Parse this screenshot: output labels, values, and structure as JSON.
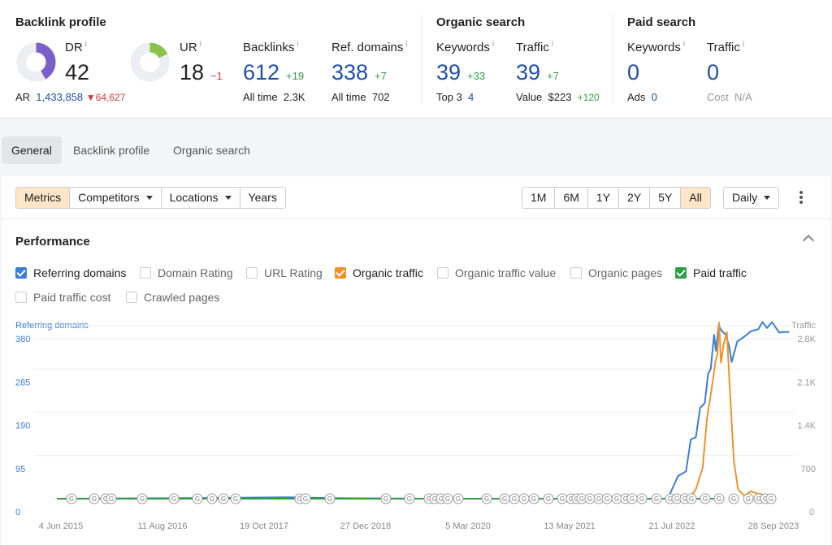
{
  "backlink_profile": {
    "title": "Backlink profile",
    "dr": {
      "label": "DR",
      "info": "i",
      "value": "42",
      "fill_percent": 42,
      "color": "#7a5fc9"
    },
    "ar": {
      "label": "AR",
      "value": "1,433,858",
      "delta": "64,627"
    },
    "ur": {
      "label": "UR",
      "info": "i",
      "value": "18",
      "delta": "−1",
      "fill_percent": 18,
      "color": "#8bc34a"
    },
    "backlinks": {
      "label": "Backlinks",
      "info": "i",
      "value": "612",
      "delta": "+19",
      "sub_label": "All time",
      "sub_value": "2.3K"
    },
    "ref_domains": {
      "label": "Ref. domains",
      "info": "i",
      "value": "338",
      "delta": "+7",
      "sub_label": "All time",
      "sub_value": "702"
    }
  },
  "organic_search": {
    "title": "Organic search",
    "keywords": {
      "label": "Keywords",
      "info": "i",
      "value": "39",
      "delta": "+33",
      "sub_label": "Top 3",
      "sub_value": "4"
    },
    "traffic": {
      "label": "Traffic",
      "info": "i",
      "value": "39",
      "delta": "+7",
      "sub_label": "Value",
      "sub_value": "$223",
      "sub_delta": "+120"
    }
  },
  "paid_search": {
    "title": "Paid search",
    "keywords": {
      "label": "Keywords",
      "info": "i",
      "value": "0",
      "sub_label": "Ads",
      "sub_value": "0"
    },
    "traffic": {
      "label": "Traffic",
      "info": "i",
      "value": "0",
      "sub_label": "Cost",
      "sub_value": "N/A"
    }
  },
  "tabs": [
    "General",
    "Backlink profile",
    "Organic search"
  ],
  "toolbar": {
    "metrics": "Metrics",
    "competitors": "Competitors",
    "locations": "Locations",
    "years": "Years",
    "ranges": [
      "1M",
      "6M",
      "1Y",
      "2Y",
      "5Y",
      "All"
    ],
    "active_range": "All",
    "interval": "Daily"
  },
  "performance": {
    "title": "Performance",
    "checkboxes": [
      {
        "label": "Referring domains",
        "checked": true,
        "color": "#3b7dd8"
      },
      {
        "label": "Domain Rating",
        "checked": false
      },
      {
        "label": "URL Rating",
        "checked": false
      },
      {
        "label": "Organic traffic",
        "checked": true,
        "color": "#f0922b"
      },
      {
        "label": "Organic traffic value",
        "checked": false
      },
      {
        "label": "Organic pages",
        "checked": false
      },
      {
        "label": "Paid traffic",
        "checked": true,
        "color": "#2f9e44"
      },
      {
        "label": "Paid traffic cost",
        "checked": false
      },
      {
        "label": "Crawled pages",
        "checked": false
      }
    ]
  },
  "chart_data": {
    "type": "line",
    "left_axis_label": "Referring domains",
    "right_axis_label": "Traffic",
    "left_ticks": [
      "0",
      "95",
      "190",
      "285",
      "380"
    ],
    "right_ticks": [
      "",
      "700",
      "1.4K",
      "2.1K",
      "2.8K"
    ],
    "left_ylim": [
      0,
      380
    ],
    "right_ylim": [
      0,
      2800
    ],
    "x_ticks": [
      "4 Jun 2015",
      "11 Aug 2016",
      "19 Oct 2017",
      "27 Dec 2018",
      "5 Mar 2020",
      "13 May 2021",
      "21 Jul 2022",
      "28 Sep 2023"
    ],
    "xlim": [
      "2015-01-01",
      "2023-11-15"
    ],
    "grid": true,
    "series": [
      {
        "name": "Referring domains",
        "axis": "left",
        "color": "#3b7dd8",
        "points": [
          [
            "2015-01-01",
            0
          ],
          [
            "2016-06-01",
            1
          ],
          [
            "2017-10-01",
            3
          ],
          [
            "2018-06-01",
            1
          ],
          [
            "2019-06-01",
            0
          ],
          [
            "2022-05-01",
            0
          ],
          [
            "2022-06-15",
            50
          ],
          [
            "2022-07-20",
            60
          ],
          [
            "2022-08-10",
            130
          ],
          [
            "2022-09-01",
            135
          ],
          [
            "2022-09-20",
            200
          ],
          [
            "2022-10-10",
            210
          ],
          [
            "2022-10-25",
            275
          ],
          [
            "2022-11-05",
            285
          ],
          [
            "2022-11-20",
            360
          ],
          [
            "2022-11-28",
            325
          ],
          [
            "2022-12-10",
            380
          ],
          [
            "2022-12-25",
            368
          ],
          [
            "2023-01-10",
            360
          ],
          [
            "2023-01-25",
            335
          ],
          [
            "2023-02-05",
            300
          ],
          [
            "2023-03-01",
            345
          ],
          [
            "2023-04-01",
            356
          ],
          [
            "2023-05-01",
            368
          ],
          [
            "2023-06-01",
            372
          ],
          [
            "2023-06-20",
            388
          ],
          [
            "2023-07-10",
            375
          ],
          [
            "2023-08-01",
            388
          ],
          [
            "2023-09-01",
            365
          ],
          [
            "2023-09-20",
            366
          ],
          [
            "2023-10-15",
            366
          ]
        ]
      },
      {
        "name": "Organic traffic",
        "axis": "right",
        "color": "#f0922b",
        "points": [
          [
            "2022-08-01",
            0
          ],
          [
            "2022-09-01",
            150
          ],
          [
            "2022-10-01",
            500
          ],
          [
            "2022-10-20",
            1300
          ],
          [
            "2022-11-10",
            1800
          ],
          [
            "2022-11-25",
            2200
          ],
          [
            "2022-12-05",
            2350
          ],
          [
            "2022-12-12",
            2850
          ],
          [
            "2022-12-20",
            2200
          ],
          [
            "2023-01-01",
            2500
          ],
          [
            "2023-01-15",
            2700
          ],
          [
            "2023-01-25",
            2000
          ],
          [
            "2023-02-01",
            1500
          ],
          [
            "2023-02-15",
            600
          ],
          [
            "2023-03-05",
            150
          ],
          [
            "2023-04-01",
            50
          ],
          [
            "2023-05-01",
            120
          ],
          [
            "2023-06-01",
            80
          ],
          [
            "2023-07-01",
            60
          ],
          [
            "2023-07-20",
            20
          ],
          [
            "2023-08-01",
            0
          ]
        ]
      },
      {
        "name": "Paid traffic",
        "axis": "right",
        "color": "#2f9e44",
        "points": [
          [
            "2015-01-01",
            0
          ],
          [
            "2022-12-01",
            0
          ]
        ]
      }
    ]
  }
}
